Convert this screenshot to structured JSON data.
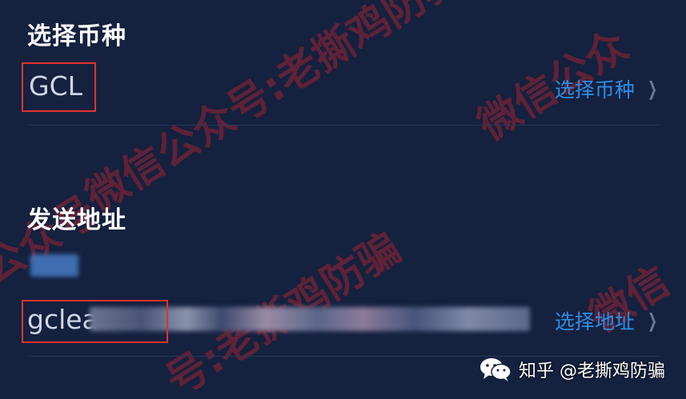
{
  "coin_section": {
    "title": "选择币种",
    "value": "GCL",
    "select_label": "选择币种"
  },
  "address_section": {
    "title": "发送地址",
    "value_prefix": "gclea",
    "select_label": "选择地址"
  },
  "watermark": {
    "text_1": "微信公众号:老撕鸡防骗",
    "text_2": "号:老撕鸡防骗",
    "text_3": "微信公众",
    "text_4": "微信",
    "text_5": "公众号",
    "badge_text": "知乎 @老撕鸡防骗"
  },
  "colors": {
    "background": "#14213f",
    "accent": "#2f8de4",
    "highlight_box": "#e0322d",
    "watermark": "#c8232d"
  },
  "icons": {
    "chevron": "chevron-right-icon",
    "badge": "wechat-icon"
  }
}
